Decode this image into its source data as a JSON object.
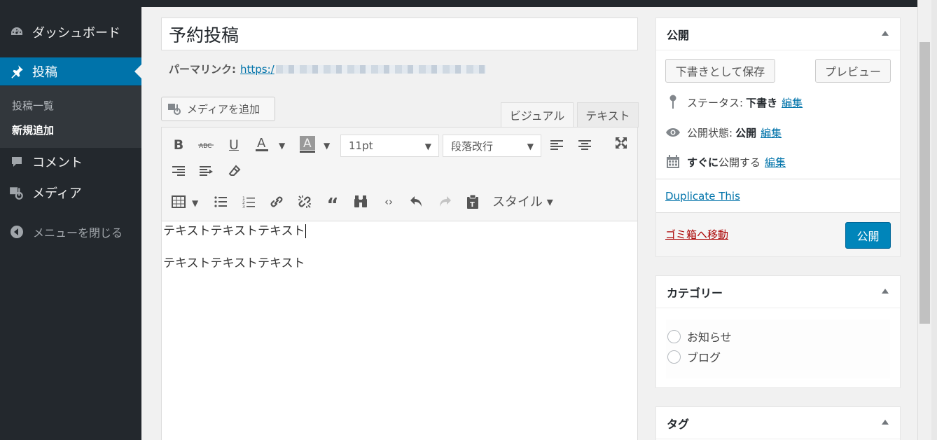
{
  "sidebar": {
    "items": [
      {
        "label": "ダッシュボード",
        "icon": "dashboard-icon"
      },
      {
        "label": "投稿",
        "icon": "pin-icon"
      },
      {
        "label": "コメント",
        "icon": "comment-icon"
      },
      {
        "label": "メディア",
        "icon": "media-icon"
      }
    ],
    "submenu": [
      {
        "label": "投稿一覧"
      },
      {
        "label": "新規追加"
      }
    ],
    "collapse_label": "メニューを閉じる"
  },
  "editor": {
    "title": "予約投稿",
    "permalink_label": "パーマリンク:",
    "permalink_url": "https:/",
    "media_button": "メディアを追加",
    "tab_visual": "ビジュアル",
    "tab_text": "テキスト",
    "font_size": "11pt",
    "format": "段落改行",
    "style_label": "スタイル ▾",
    "content": [
      "テキストテキストテキスト",
      "テキストテキストテキスト"
    ]
  },
  "publish_box": {
    "title": "公開",
    "save_draft": "下書きとして保存",
    "preview": "プレビュー",
    "status_label": "ステータス:",
    "status_value": "下書き",
    "visibility_label": "公開状態:",
    "visibility_value": "公開",
    "schedule_bold": "すぐに",
    "schedule_text": "公開する",
    "edit_link": "編集",
    "duplicate": "Duplicate This",
    "trash": "ゴミ箱へ移動",
    "publish": "公開"
  },
  "category_box": {
    "title": "カテゴリー",
    "items": [
      {
        "label": "お知らせ"
      },
      {
        "label": "ブログ"
      }
    ]
  },
  "tag_box": {
    "title": "タグ"
  },
  "colors": {
    "sidebar_bg": "#23282d",
    "accent": "#0073aa",
    "publish_button": "#0085ba",
    "trash_link": "#a00000"
  }
}
